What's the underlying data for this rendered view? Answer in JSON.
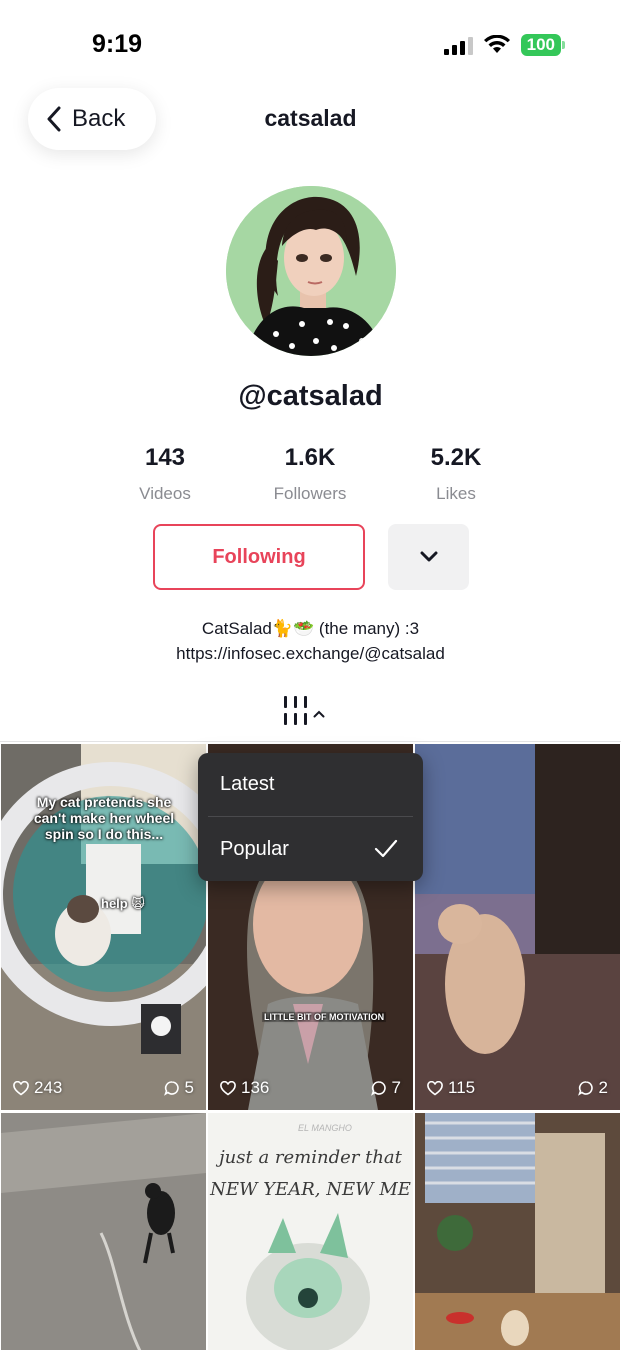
{
  "status_bar": {
    "time": "9:19",
    "battery": "100"
  },
  "header": {
    "back_label": "Back",
    "title": "catsalad"
  },
  "profile": {
    "handle": "@catsalad",
    "stats": [
      {
        "value": "143",
        "label": "Videos"
      },
      {
        "value": "1.6K",
        "label": "Followers"
      },
      {
        "value": "5.2K",
        "label": "Likes"
      }
    ],
    "follow_label": "Following",
    "bio_line1": "CatSalad🐈🥗 (the many) :3",
    "bio_line2": "https://infosec.exchange/@catsalad"
  },
  "sort_menu": {
    "options": [
      "Latest",
      "Popular"
    ],
    "selected": "Popular"
  },
  "videos": [
    {
      "caption": "My cat pretends she can't make her wheel spin so I do this...",
      "sticker": "help 🙀",
      "likes": "243",
      "comments": "5"
    },
    {
      "caption": "LITTLE BIT OF MOTIVATION",
      "likes": "136",
      "comments": "7"
    },
    {
      "likes": "115",
      "comments": "2"
    },
    {},
    {
      "caption_small": "EL MANGHO",
      "caption_line1": "just a reminder that",
      "caption_line2": "NEW YEAR, NEW ME"
    },
    {}
  ],
  "colors": {
    "accent": "#e8445a",
    "battery": "#34c759",
    "menu_bg": "#2f2f31"
  }
}
